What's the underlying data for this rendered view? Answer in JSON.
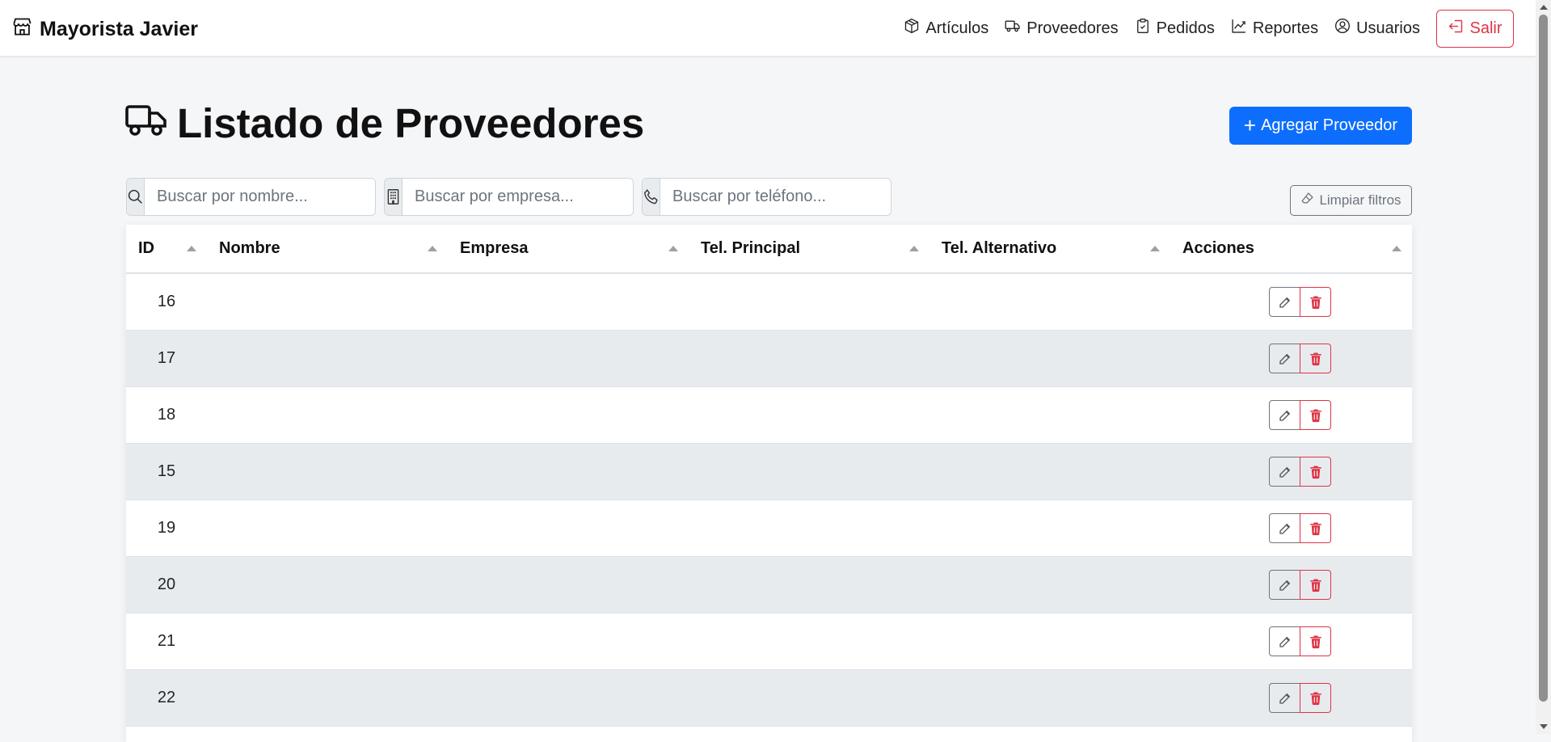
{
  "navbar": {
    "brand": "Mayorista Javier",
    "links": [
      {
        "label": "Artículos",
        "icon": "box-icon"
      },
      {
        "label": "Proveedores",
        "icon": "truck-icon"
      },
      {
        "label": "Pedidos",
        "icon": "clipboard-icon"
      },
      {
        "label": "Reportes",
        "icon": "chart-line-icon"
      },
      {
        "label": "Usuarios",
        "icon": "user-circle-icon"
      }
    ],
    "logout_label": "Salir"
  },
  "page": {
    "title": "Listado de Proveedores",
    "add_button": "Agregar Proveedor"
  },
  "filters": {
    "nombre_placeholder": "Buscar por nombre...",
    "empresa_placeholder": "Buscar por empresa...",
    "telefono_placeholder": "Buscar por teléfono...",
    "clear_label": "Limpiar filtros"
  },
  "table": {
    "columns": [
      "ID",
      "Nombre",
      "Empresa",
      "Tel. Principal",
      "Tel. Alternativo",
      "Acciones"
    ],
    "rows": [
      {
        "id": "16",
        "nombre": "",
        "empresa": "",
        "tel1": "",
        "tel2": ""
      },
      {
        "id": "17",
        "nombre": "",
        "empresa": "",
        "tel1": "",
        "tel2": ""
      },
      {
        "id": "18",
        "nombre": "",
        "empresa": "",
        "tel1": "",
        "tel2": ""
      },
      {
        "id": "15",
        "nombre": "",
        "empresa": "",
        "tel1": "",
        "tel2": ""
      },
      {
        "id": "19",
        "nombre": "",
        "empresa": "",
        "tel1": "",
        "tel2": ""
      },
      {
        "id": "20",
        "nombre": "",
        "empresa": "",
        "tel1": "",
        "tel2": ""
      },
      {
        "id": "21",
        "nombre": "",
        "empresa": "",
        "tel1": "",
        "tel2": ""
      },
      {
        "id": "22",
        "nombre": "",
        "empresa": "",
        "tel1": "",
        "tel2": ""
      }
    ]
  },
  "colors": {
    "primary": "#0d6efd",
    "danger": "#dc3545",
    "secondary": "#6c757d",
    "stripe": "#e8ebee"
  }
}
